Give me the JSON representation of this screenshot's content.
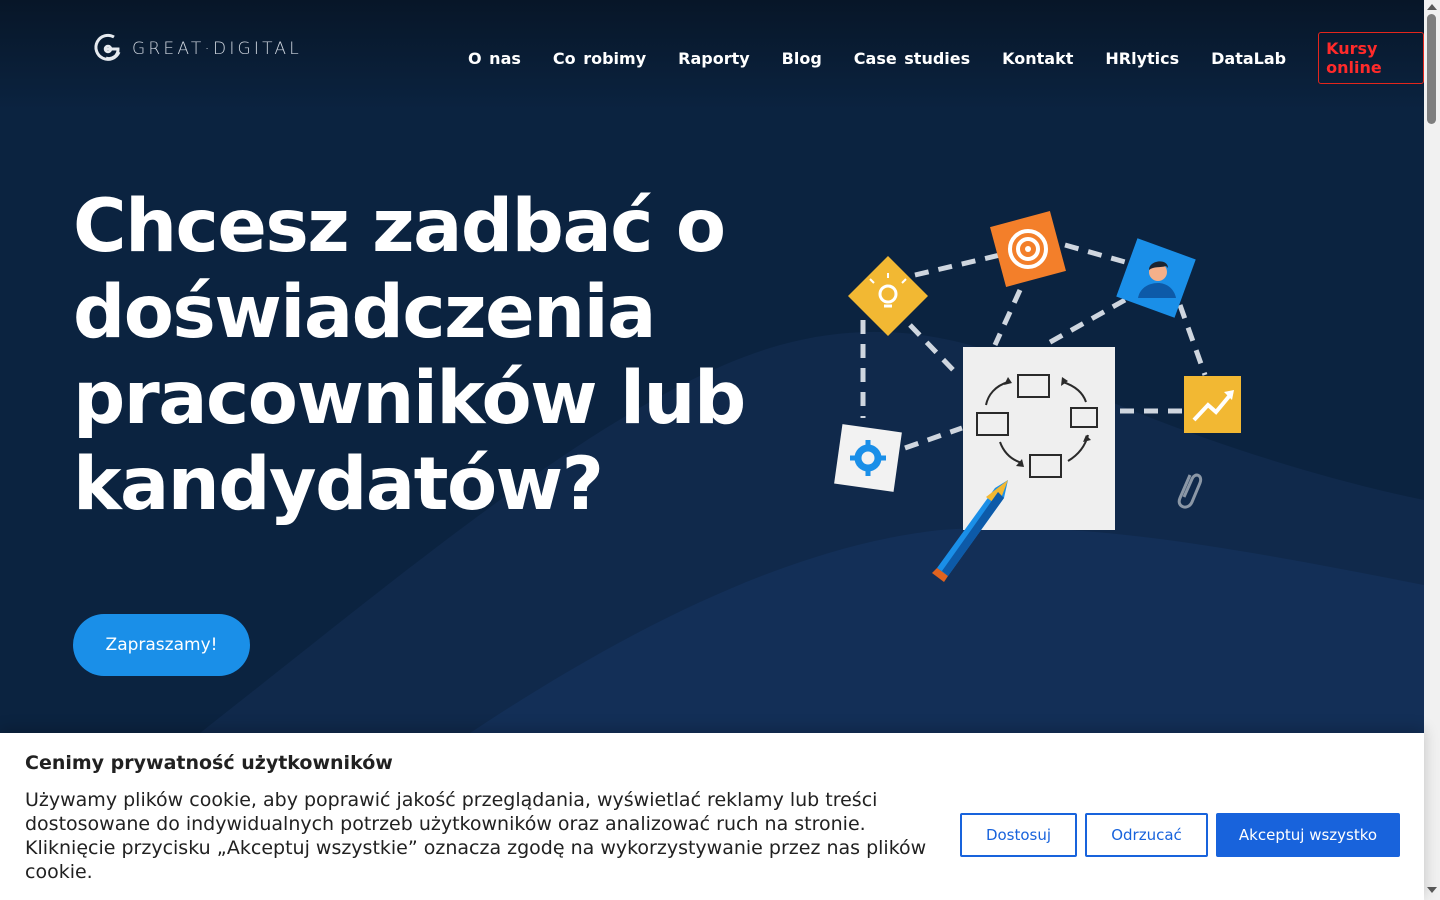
{
  "brand": {
    "logo_text": "GREAT·DIGITAL",
    "colors": {
      "navy": "#0b2340",
      "wave": "#132f57",
      "accent_blue": "#1a8fe8",
      "cta_red": "#e3261c",
      "cookie_blue": "#1863dc"
    }
  },
  "nav": {
    "items": [
      {
        "label": "O nas"
      },
      {
        "label": "Co robimy"
      },
      {
        "label": "Raporty"
      },
      {
        "label": "Blog"
      },
      {
        "label": "Case studies"
      },
      {
        "label": "Kontakt"
      },
      {
        "label": "HRlytics"
      },
      {
        "label": "DataLab"
      }
    ],
    "cta_label": "Kursy online"
  },
  "hero": {
    "headline_lines": [
      "Chcesz zadbać o",
      "doświadczenia",
      "pracowników lub",
      "kandydatów?"
    ],
    "button_label": "Zapraszamy!"
  },
  "illustration_icons": [
    "lightbulb-icon",
    "target-icon",
    "user-avatar-icon",
    "gear-icon",
    "growth-chart-icon",
    "process-cycle-document-icon",
    "pencil-icon",
    "paperclip-icon"
  ],
  "cookie_banner": {
    "title": "Cenimy prywatność użytkowników",
    "text": "Używamy plików cookie, aby poprawić jakość przeglądania, wyświetlać reklamy lub treści dostosowane do indywidualnych potrzeb użytkowników oraz analizować ruch na stronie. Kliknięcie przycisku „Akceptuj wszystkie” oznacza zgodę na wykorzystywanie przez nas plików cookie.",
    "customize_label": "Dostosuj",
    "reject_label": "Odrzucać",
    "accept_label": "Akceptuj wszystko"
  }
}
